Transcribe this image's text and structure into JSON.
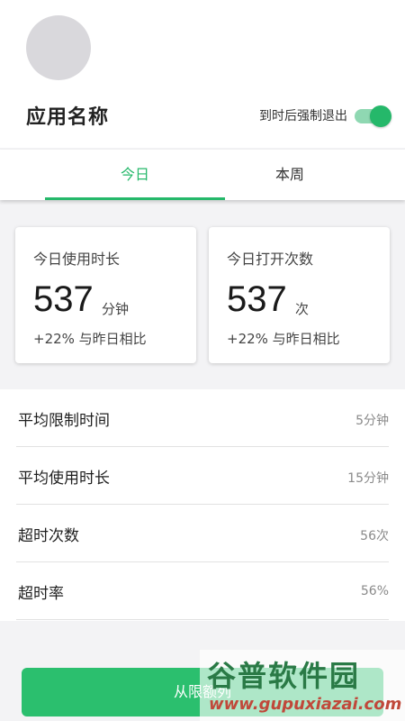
{
  "header": {
    "app_name": "应用名称",
    "force_exit_label": "到时后强制退出",
    "force_exit_on": true
  },
  "tabs": [
    {
      "label": "今日",
      "active": true
    },
    {
      "label": "本周",
      "active": false
    }
  ],
  "cards": [
    {
      "title": "今日使用时长",
      "value": "537",
      "unit": "分钟",
      "compare": "+22% 与昨日相比"
    },
    {
      "title": "今日打开次数",
      "value": "537",
      "unit": "次",
      "compare": "+22% 与昨日相比"
    }
  ],
  "stats": [
    {
      "label": "平均限制时间",
      "value": "5分钟"
    },
    {
      "label": "平均使用时长",
      "value": "15分钟"
    },
    {
      "label": "超时次数",
      "value": "56次"
    },
    {
      "label": "超时率",
      "value": "56%"
    }
  ],
  "action": {
    "label": "从限额列"
  },
  "watermark": {
    "main": "谷普软件园",
    "url": "www.gupuxiazai.com"
  },
  "colors": {
    "accent": "#25b86a",
    "button": "#2bbf6e",
    "toggle_track": "#8fd8b2"
  }
}
